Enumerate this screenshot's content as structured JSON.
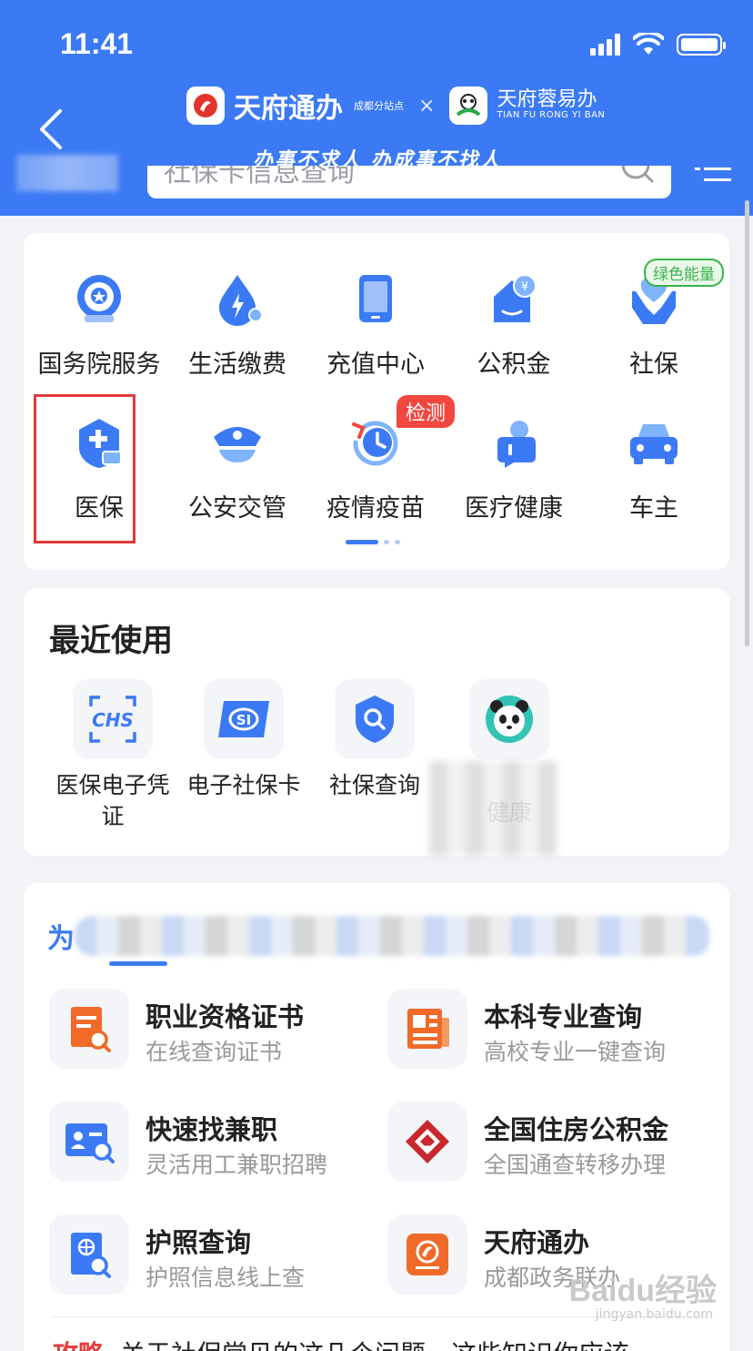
{
  "status_bar": {
    "time": "11:41"
  },
  "header": {
    "brand_name": "天府通办",
    "brand_sub": "成都分站点",
    "brand_x": "×",
    "brand2_name": "天府蓉易办",
    "brand2_en": "TIAN FU RONG YI BAN",
    "slogan": "办事不求人 办成事不找人",
    "search_placeholder": "社保卡信息查询"
  },
  "services_grid": {
    "items": [
      {
        "label": "国务院服务",
        "icon": "state-council-icon"
      },
      {
        "label": "生活缴费",
        "icon": "payment-drop-icon"
      },
      {
        "label": "充值中心",
        "icon": "phone-recharge-icon"
      },
      {
        "label": "公积金",
        "icon": "housing-fund-icon"
      },
      {
        "label": "社保",
        "icon": "social-security-hands-icon"
      },
      {
        "label": "医保",
        "icon": "medical-insurance-shield-icon"
      },
      {
        "label": "公安交管",
        "icon": "police-cap-icon"
      },
      {
        "label": "疫情疫苗",
        "icon": "epidemic-clock-icon"
      },
      {
        "label": "医疗健康",
        "icon": "medical-health-icon"
      },
      {
        "label": "车主",
        "icon": "car-icon"
      }
    ],
    "badge_green": "绿色能量",
    "badge_red": "检测",
    "page_index": 1,
    "page_count": 3
  },
  "recent": {
    "title": "最近使用",
    "items": [
      {
        "label": "医保电子凭证",
        "icon": "chs-icon"
      },
      {
        "label": "电子社保卡",
        "icon": "si-card-icon"
      },
      {
        "label": "社保查询",
        "icon": "search-shield-icon"
      },
      {
        "label": "健康",
        "icon": "panda-icon"
      }
    ]
  },
  "recommend": {
    "tab_first": "为",
    "items": [
      {
        "title": "职业资格证书",
        "subtitle": "在线查询证书",
        "icon": "certificate-search-icon"
      },
      {
        "title": "本科专业查询",
        "subtitle": "高校专业一键查询",
        "icon": "newspaper-icon"
      },
      {
        "title": "快速找兼职",
        "subtitle": "灵活用工兼职招聘",
        "icon": "id-card-search-icon"
      },
      {
        "title": "全国住房公积金",
        "subtitle": "全国通查转移办理",
        "icon": "housing-fund-logo-icon"
      },
      {
        "title": "护照查询",
        "subtitle": "护照信息线上查",
        "icon": "passport-search-icon"
      },
      {
        "title": "天府通办",
        "subtitle": "成都政务联办",
        "icon": "tianfu-app-icon"
      }
    ],
    "bottom_tag": "攻略",
    "bottom_text": "关于社保常见的这几个问题，这些知识你应该"
  },
  "watermark": {
    "text": "Baidu经验",
    "sub": "jingyan.baidu.com"
  }
}
